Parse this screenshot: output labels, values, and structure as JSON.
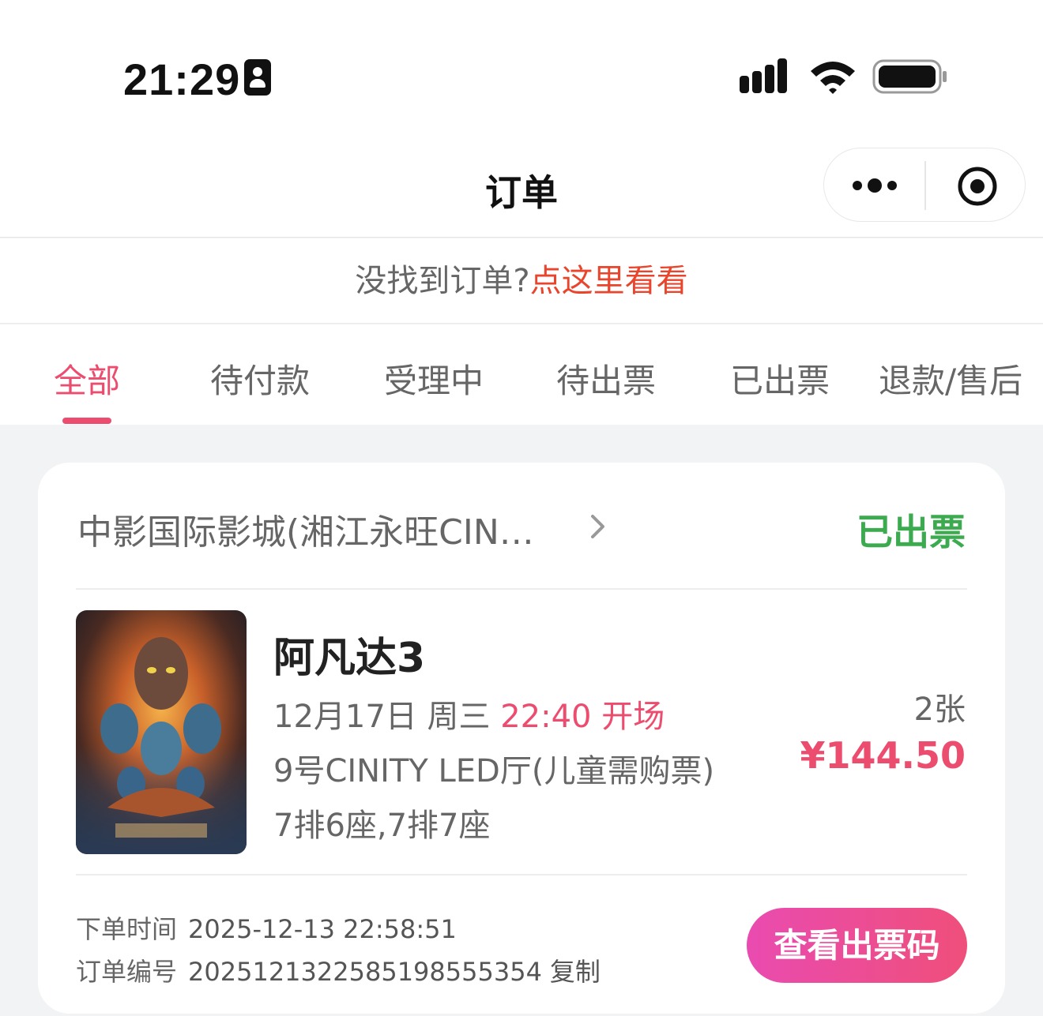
{
  "status_bar": {
    "time": "21:29"
  },
  "nav": {
    "title": "订单"
  },
  "hint": {
    "text": "没找到订单?",
    "link": "点这里看看"
  },
  "tabs": [
    {
      "label": "全部",
      "active": true
    },
    {
      "label": "待付款",
      "active": false
    },
    {
      "label": "受理中",
      "active": false
    },
    {
      "label": "待出票",
      "active": false
    },
    {
      "label": "已出票",
      "active": false
    },
    {
      "label": "退款/售后",
      "active": false
    }
  ],
  "order": {
    "cinema": "中影国际影城(湘江永旺CIN…",
    "status": "已出票",
    "movie_title": "阿凡达3",
    "date": "12月17日 周三",
    "start_time": "22:40 开场",
    "hall": "9号CINITY LED厅(儿童需购票)",
    "seats": "7排6座,7排7座",
    "ticket_count": "2张",
    "price": "¥144.50",
    "order_time_label": "下单时间",
    "order_time": "2025-12-13 22:58:51",
    "order_no_label": "订单编号",
    "order_no": "2025121322585198555354",
    "copy_label": "复制",
    "view_ticket_label": "查看出票码"
  },
  "colors": {
    "accent": "#ec4c6e",
    "status_green": "#3cab4f",
    "link_red": "#e8452c"
  }
}
